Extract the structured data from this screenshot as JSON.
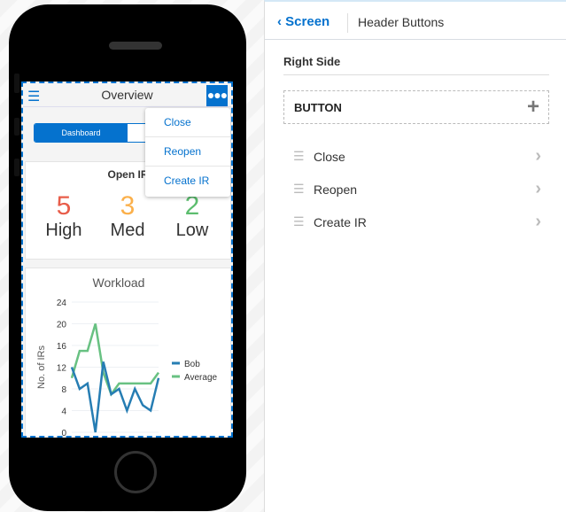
{
  "phone": {
    "header": {
      "title": "Overview",
      "menu_icon": "hamburger-icon",
      "more_icon": "ellipsis-icon"
    },
    "segmented": {
      "active": "Dashboard"
    },
    "open_card": {
      "title": "Open IR",
      "stats": [
        {
          "value": "5",
          "label": "High",
          "color": "#e85d4a"
        },
        {
          "value": "3",
          "label": "Med",
          "color": "#fbb04b"
        },
        {
          "value": "2",
          "label": "Low",
          "color": "#5cbd6e"
        }
      ]
    },
    "dropdown": [
      "Close",
      "Reopen",
      "Create IR"
    ]
  },
  "chart_data": {
    "type": "line",
    "title": "Workload",
    "ylabel": "No. of IRs",
    "ylim": [
      0,
      24
    ],
    "yticks": [
      0,
      4,
      8,
      12,
      16,
      20,
      24
    ],
    "legend": "right",
    "grid": true,
    "series": [
      {
        "name": "Bob",
        "color": "#267db3",
        "values": [
          12,
          8,
          9,
          0,
          13,
          7,
          8,
          4,
          8,
          5,
          4,
          10
        ]
      },
      {
        "name": "Average",
        "color": "#68c182",
        "values": [
          10,
          15,
          15,
          20,
          11,
          7,
          9,
          9,
          9,
          9,
          9,
          11
        ]
      }
    ]
  },
  "panel": {
    "back": "Screen",
    "breadcrumb": "Header Buttons",
    "section": "Right Side",
    "add_label": "BUTTON",
    "items": [
      "Close",
      "Reopen",
      "Create IR"
    ]
  }
}
